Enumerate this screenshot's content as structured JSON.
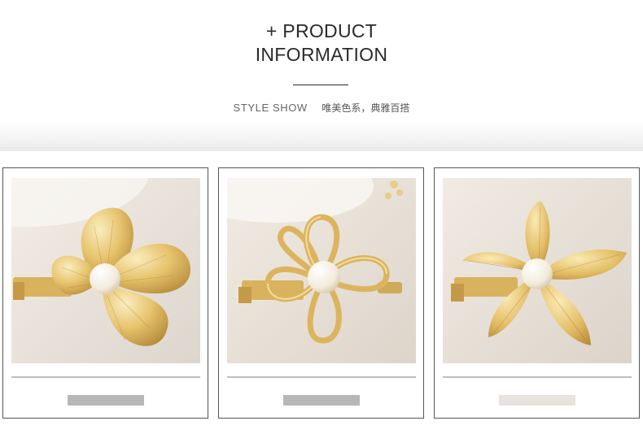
{
  "header": {
    "title_line1": "+ PRODUCT",
    "title_line2": "INFORMATION"
  },
  "subtitle": {
    "en": "STYLE SHOW",
    "cn": "唯美色系，典雅百搭"
  },
  "products": [
    {
      "name": "gold-four-petal-pearl-hair-clip",
      "swatch_color": "#b7b7b7"
    },
    {
      "name": "gold-openwork-flower-pearl-hair-clip",
      "swatch_color": "#b7b7b7"
    },
    {
      "name": "gold-five-petal-pearl-hair-clip",
      "swatch_color": "#e7e3dd"
    }
  ],
  "colors": {
    "gold_light": "#f7e3a4",
    "gold_mid": "#e2bf68",
    "gold_dark": "#b58a37",
    "pearl": "#f7f1e6",
    "divider": "#bdbdbd",
    "card_border": "#555555"
  }
}
